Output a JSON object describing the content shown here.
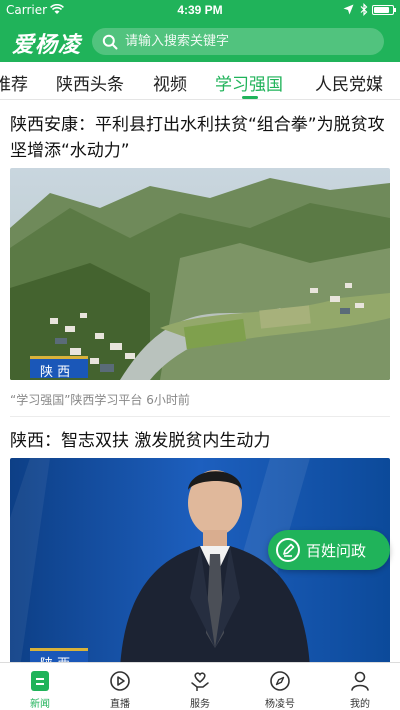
{
  "status_bar": {
    "carrier": "Carrier",
    "time": "4:39 PM",
    "battery_level": 0.85
  },
  "header": {
    "logo_text": "爱杨凌",
    "search": {
      "placeholder": "请输入搜索关键字",
      "value": ""
    }
  },
  "tabs": [
    {
      "label": "推荐",
      "active": false
    },
    {
      "label": "陕西头条",
      "active": false
    },
    {
      "label": "视频",
      "active": false
    },
    {
      "label": "学习强国",
      "active": true
    },
    {
      "label": "人民党媒",
      "active": false
    }
  ],
  "articles": [
    {
      "title": "陕西安康：平利县打出水利扶贫“组合拳”为脱贫攻坚增添“水动力”",
      "image_caption": "陕 西",
      "source": "“学习强国”陕西学习平台",
      "time": "6小时前"
    },
    {
      "title": "陕西：智志双扶 激发脱贫内生动力",
      "image_caption": "陕 西"
    }
  ],
  "float_button": {
    "label": "百姓问政",
    "icon": "edit-icon"
  },
  "bottom_tabs": [
    {
      "label": "新闻",
      "icon": "news-icon",
      "active": true
    },
    {
      "label": "直播",
      "icon": "play-icon",
      "active": false
    },
    {
      "label": "服务",
      "icon": "heart-hand-icon",
      "active": false
    },
    {
      "label": "杨凌号",
      "icon": "compass-icon",
      "active": false
    },
    {
      "label": "我的",
      "icon": "user-icon",
      "active": false
    }
  ],
  "colors": {
    "brand_green": "#20b35a",
    "tab_text": "#222222",
    "meta_text": "#888888"
  }
}
